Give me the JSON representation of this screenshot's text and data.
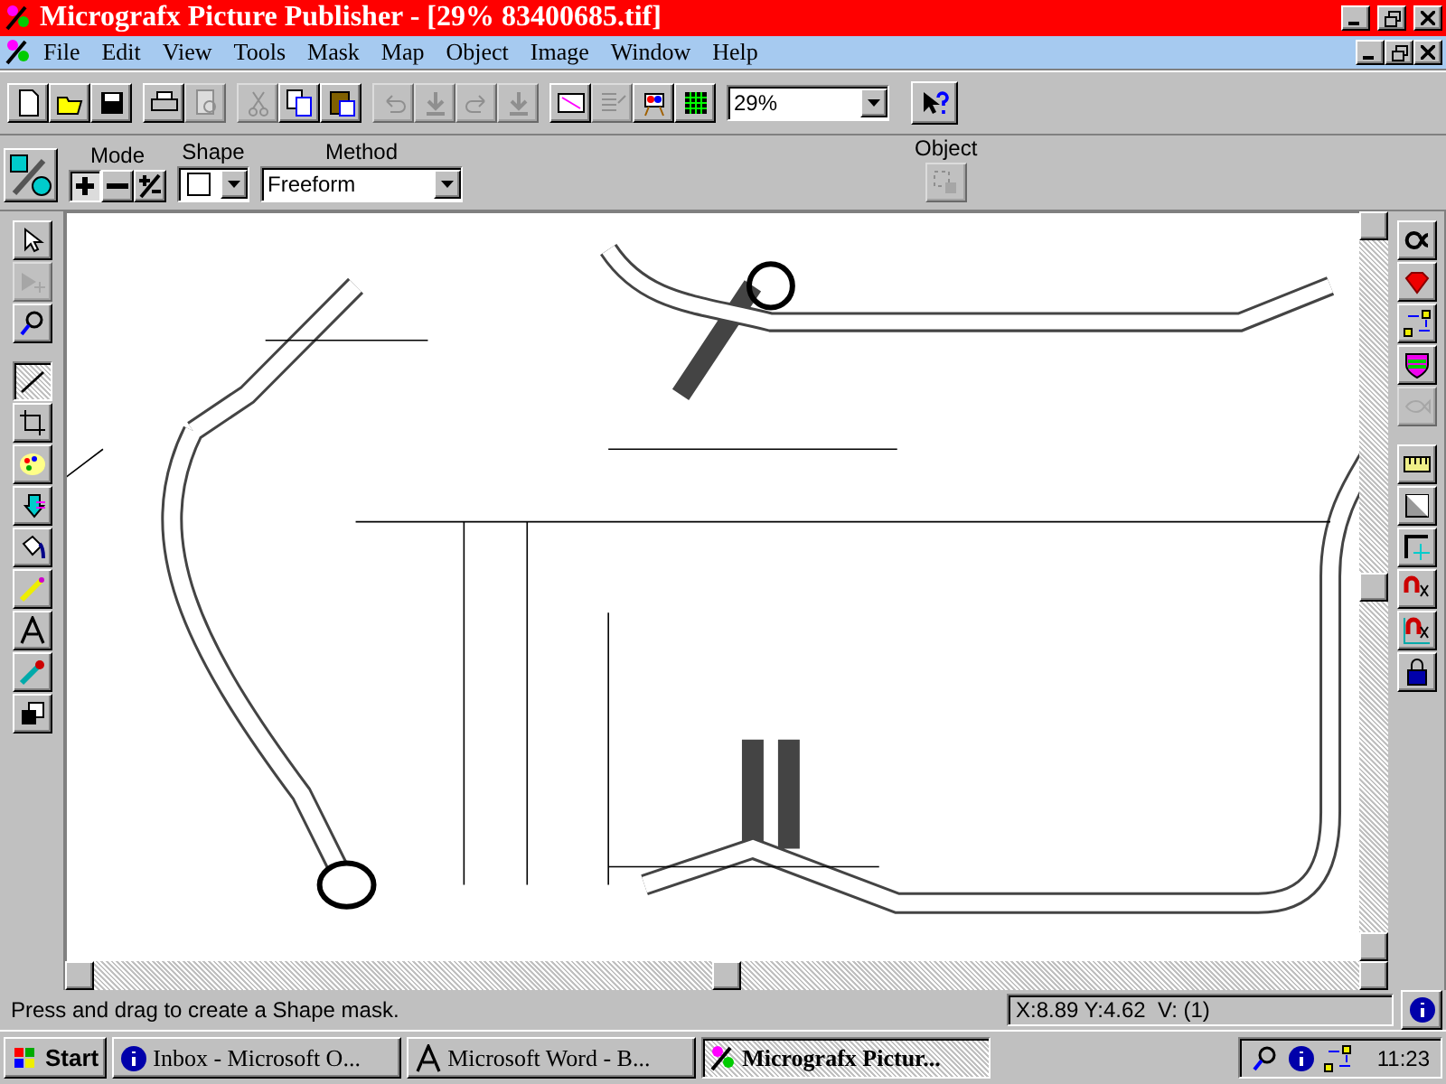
{
  "window": {
    "title": "Micrografx Picture Publisher - [29% 83400685.tif]"
  },
  "menu": [
    "File",
    "Edit",
    "View",
    "Tools",
    "Mask",
    "Map",
    "Object",
    "Image",
    "Window",
    "Help"
  ],
  "toolbar": [
    {
      "kind": "new",
      "disabled": false
    },
    {
      "kind": "open",
      "disabled": false
    },
    {
      "kind": "save",
      "disabled": false
    },
    {
      "kind": "sep"
    },
    {
      "kind": "print",
      "disabled": false
    },
    {
      "kind": "preview",
      "disabled": true
    },
    {
      "kind": "sep"
    },
    {
      "kind": "cut",
      "disabled": true
    },
    {
      "kind": "copy",
      "disabled": false
    },
    {
      "kind": "paste",
      "disabled": false
    },
    {
      "kind": "sep"
    },
    {
      "kind": "undo",
      "disabled": true
    },
    {
      "kind": "down",
      "disabled": true
    },
    {
      "kind": "redo",
      "disabled": true
    },
    {
      "kind": "down",
      "disabled": true
    },
    {
      "kind": "sep"
    },
    {
      "kind": "film",
      "disabled": false
    },
    {
      "kind": "list",
      "disabled": true
    },
    {
      "kind": "easel",
      "disabled": false
    },
    {
      "kind": "grid",
      "disabled": false
    }
  ],
  "zoom": {
    "value": "29%"
  },
  "mask_bar": {
    "mode_label": "Mode",
    "modes": [
      {
        "kind": "add",
        "selected": true
      },
      {
        "kind": "subtract",
        "selected": false
      },
      {
        "kind": "toggle",
        "selected": false
      }
    ],
    "shape_label": "Shape",
    "method_label": "Method",
    "method": "Freeform",
    "object_label": "Object"
  },
  "left_tools": [
    {
      "kind": "arrow",
      "selected": false,
      "disabled": false
    },
    {
      "kind": "move",
      "selected": false,
      "disabled": true
    },
    {
      "kind": "zoom",
      "selected": false,
      "disabled": false
    },
    {
      "kind": "line",
      "selected": true,
      "disabled": false
    },
    {
      "kind": "crop",
      "selected": false,
      "disabled": false
    },
    {
      "kind": "palette",
      "selected": false,
      "disabled": false
    },
    {
      "kind": "stamp",
      "selected": false,
      "disabled": false
    },
    {
      "kind": "bucket",
      "selected": false,
      "disabled": false
    },
    {
      "kind": "pencil",
      "selected": false,
      "disabled": false
    },
    {
      "kind": "text",
      "selected": false,
      "disabled": false
    },
    {
      "kind": "dropper",
      "selected": false,
      "disabled": false
    },
    {
      "kind": "colors",
      "selected": false,
      "disabled": false
    }
  ],
  "right_tools": [
    {
      "kind": "alpha",
      "disabled": false
    },
    {
      "kind": "gem",
      "disabled": false
    },
    {
      "kind": "arrange",
      "disabled": false
    },
    {
      "kind": "shield",
      "disabled": false
    },
    {
      "kind": "fish",
      "disabled": true
    },
    {
      "kind": "sep"
    },
    {
      "kind": "ruler",
      "disabled": false
    },
    {
      "kind": "gradient",
      "disabled": false
    },
    {
      "kind": "corner",
      "disabled": false
    },
    {
      "kind": "magnet",
      "disabled": false
    },
    {
      "kind": "magnet2",
      "disabled": false
    },
    {
      "kind": "lock",
      "disabled": false
    }
  ],
  "status_bar": {
    "message": "Press and drag to create a Shape mask.",
    "coords": "X:8.89 Y:4.62  V: (1)"
  },
  "taskbar": {
    "start": "Start",
    "tasks": [
      {
        "label": "Inbox - Microsoft O...",
        "selected": false
      },
      {
        "label": "Microsoft Word - B...",
        "selected": false
      },
      {
        "label": "Micrografx Pictur...",
        "selected": true
      }
    ],
    "clock": "11:23"
  }
}
